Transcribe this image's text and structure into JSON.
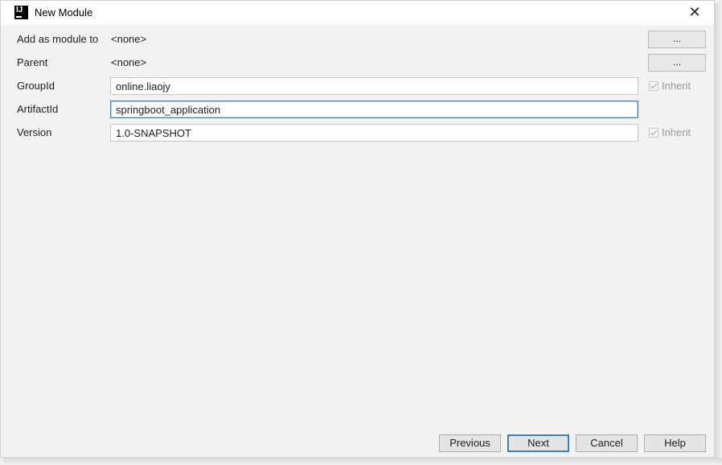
{
  "window": {
    "title": "New Module",
    "close_glyph": "✕"
  },
  "form": {
    "add_as_module_to": {
      "label": "Add as module to",
      "value": "<none>",
      "browse_label": "..."
    },
    "parent": {
      "label": "Parent",
      "value": "<none>",
      "browse_label": "..."
    },
    "group_id": {
      "label": "GroupId",
      "value": "online.liaojy",
      "inherit_label": "Inherit",
      "inherit_checked": true
    },
    "artifact_id": {
      "label": "ArtifactId",
      "value": "springboot_application"
    },
    "version": {
      "label": "Version",
      "value": "1.0-SNAPSHOT",
      "inherit_label": "Inherit",
      "inherit_checked": true
    }
  },
  "footer": {
    "previous_label": "Previous",
    "next_label": "Next",
    "cancel_label": "Cancel",
    "help_label": "Help"
  },
  "icons": {
    "app": "intellij-idea-icon",
    "close": "close-icon",
    "checkbox": "checkmark-icon"
  },
  "colors": {
    "accent": "#3c7fb1",
    "background": "#f2f2f2",
    "disabled_text": "#9a9a9a"
  }
}
